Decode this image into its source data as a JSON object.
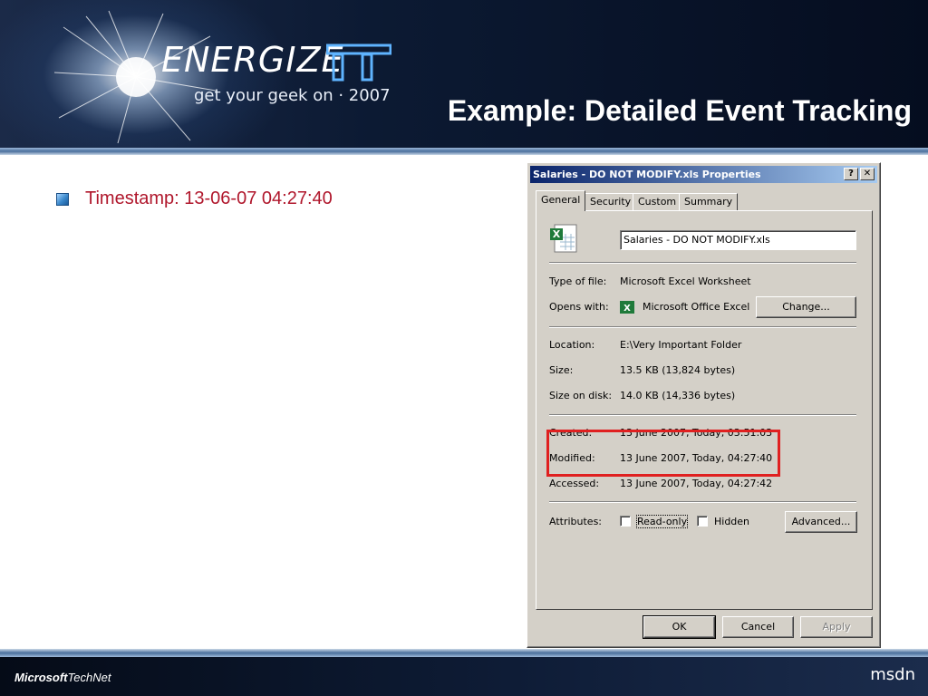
{
  "header": {
    "logo_word": "ENERGIZE",
    "logo_suffix": "IT",
    "tagline": "get your geek on · 2007",
    "slide_title": "Example: Detailed Event Tracking"
  },
  "bullets": [
    {
      "text": "Timestamp: 13-06-07 04:27:40"
    }
  ],
  "dialog": {
    "title": "Salaries - DO NOT MODIFY.xls Properties",
    "help_label": "?",
    "close_label": "✕",
    "tabs": [
      "General",
      "Security",
      "Custom",
      "Summary"
    ],
    "active_tab": "General",
    "filename": "Salaries - DO NOT MODIFY.xls",
    "rows": {
      "type_label": "Type of file:",
      "type_value": "Microsoft Excel Worksheet",
      "opens_label": "Opens with:",
      "opens_value": "Microsoft Office Excel",
      "change_button": "Change...",
      "location_label": "Location:",
      "location_value": "E:\\Very Important Folder",
      "size_label": "Size:",
      "size_value": "13.5 KB (13,824 bytes)",
      "disk_label": "Size on disk:",
      "disk_value": "14.0 KB (14,336 bytes)",
      "created_label": "Created:",
      "created_value": "13 June 2007, Today, 03:51:03",
      "modified_label": "Modified:",
      "modified_value": "13 June 2007, Today, 04:27:40",
      "accessed_label": "Accessed:",
      "accessed_value": "13 June 2007, Today, 04:27:42"
    },
    "attributes": {
      "label": "Attributes:",
      "readonly_label": "Read-only",
      "readonly_checked": false,
      "hidden_label": "Hidden",
      "hidden_checked": false,
      "advanced_button": "Advanced..."
    },
    "buttons": {
      "ok": "OK",
      "cancel": "Cancel",
      "apply": "Apply"
    }
  },
  "annotation": {
    "highlight_color": "#e02020"
  },
  "footer": {
    "left_logo_bold": "Microsoft",
    "left_logo_rest": "TechNet",
    "right_logo": "msdn"
  }
}
